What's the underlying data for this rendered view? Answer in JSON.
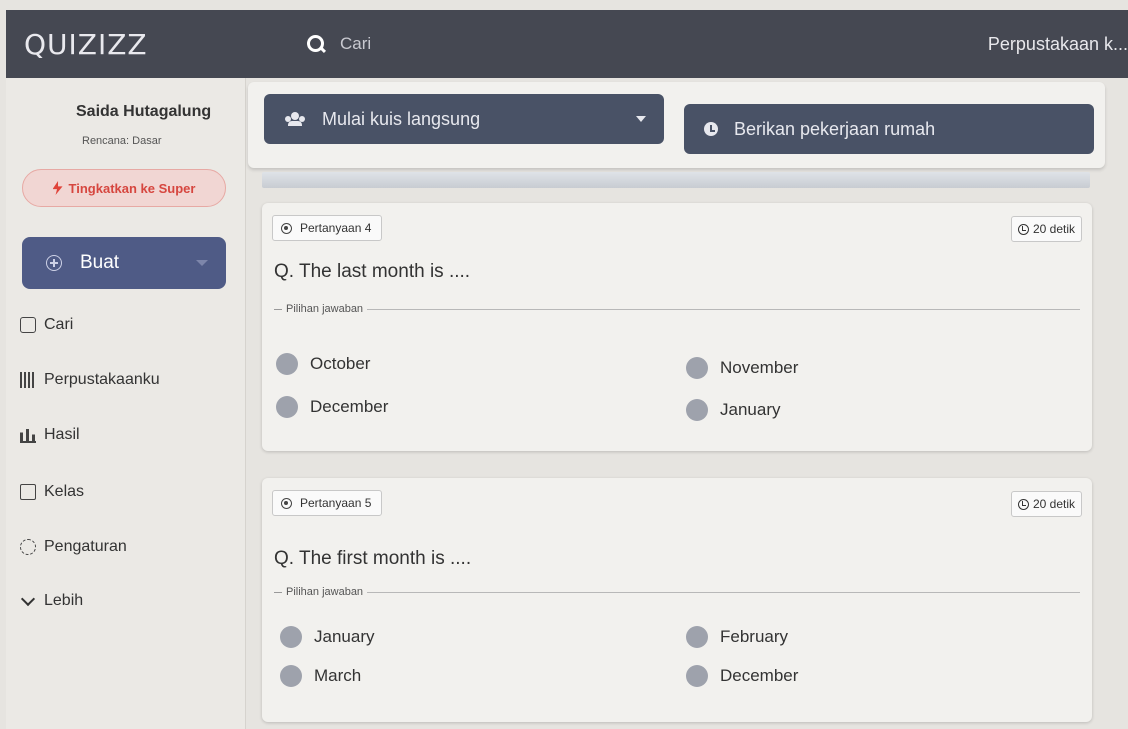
{
  "header": {
    "logo": "QUIZIZZ",
    "search_placeholder": "Cari",
    "right_text": "Perpustakaan k..."
  },
  "sidebar": {
    "user_name": "Saida Hutagalung",
    "plan": "Rencana: Dasar",
    "upgrade_label": "Tingkatkan ke Super",
    "create_label": "Buat",
    "nav": [
      {
        "label": "Cari",
        "icon": "search-grid-icon"
      },
      {
        "label": "Perpustakaanku",
        "icon": "library-icon"
      },
      {
        "label": "Hasil",
        "icon": "results-icon"
      },
      {
        "label": "Kelas",
        "icon": "class-icon"
      },
      {
        "label": "Pengaturan",
        "icon": "settings-icon"
      },
      {
        "label": "Lebih",
        "icon": "chevron-down-icon"
      }
    ]
  },
  "actions": {
    "live_label": "Mulai kuis langsung",
    "homework_label": "Berikan pekerjaan rumah"
  },
  "questions": [
    {
      "badge": "Pertanyaan 4",
      "time": "20 detik",
      "text": "Q. The last month is ....",
      "answers_label": "Pilihan jawaban",
      "options": [
        "October",
        "November",
        "December",
        "January"
      ]
    },
    {
      "badge": "Pertanyaan 5",
      "time": "20 detik",
      "text": "Q. The first month is ....",
      "answers_label": "Pilihan jawaban",
      "options": [
        "January",
        "February",
        "March",
        "December"
      ]
    }
  ],
  "colors": {
    "topbar": "#454852",
    "primary_button": "#4f5b86",
    "action_button": "#495266",
    "upgrade_text": "#d6463f"
  }
}
